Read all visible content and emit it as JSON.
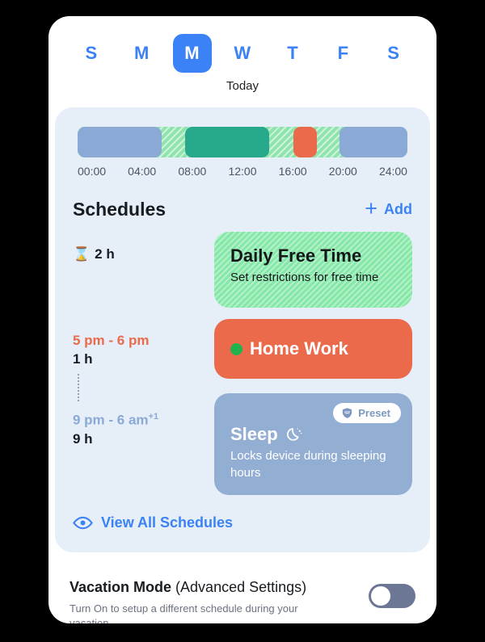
{
  "colors": {
    "accent_blue": "#3b82f6",
    "panel_bg": "#e6eef8",
    "card_green": "#85e8a8",
    "card_orange": "#ec6a4c",
    "card_blue": "#93aed3",
    "timeline_green": "#8fe4ae",
    "timeline_blue": "#8aaad5",
    "timeline_teal": "#27a98b",
    "timeline_orange": "#ec6a4c",
    "toggle_off": "#6b7795"
  },
  "day_selector": {
    "today_label": "Today",
    "days": [
      {
        "label": "S",
        "selected": false
      },
      {
        "label": "M",
        "selected": false
      },
      {
        "label": "M",
        "selected": true
      },
      {
        "label": "W",
        "selected": false
      },
      {
        "label": "T",
        "selected": false
      },
      {
        "label": "F",
        "selected": false
      },
      {
        "label": "S",
        "selected": false
      }
    ]
  },
  "timeline": {
    "tick_labels": [
      "00:00",
      "04:00",
      "08:00",
      "12:00",
      "16:00",
      "20:00",
      "24:00"
    ],
    "background_fill": "free-time-striped-green",
    "segments": [
      {
        "name": "sleep-morning",
        "color": "#8aaad5",
        "left_pct": 0.0,
        "width_pct": 25.5
      },
      {
        "name": "school",
        "color": "#27a98b",
        "left_pct": 32.5,
        "width_pct": 25.5
      },
      {
        "name": "home-work",
        "color": "#ec6a4c",
        "left_pct": 65.5,
        "width_pct": 7.0
      },
      {
        "name": "sleep-night",
        "color": "#8aaad5",
        "left_pct": 79.5,
        "width_pct": 20.5
      }
    ]
  },
  "schedules_section": {
    "title": "Schedules",
    "add_label": "Add",
    "add_icon": "plus-icon",
    "view_all_label": "View All Schedules",
    "view_all_icon": "eye-icon"
  },
  "schedules": [
    {
      "meta_icon": "hourglass-icon",
      "meta_time": "",
      "meta_time_sup": "",
      "duration": "2 h",
      "time_color": "#181c20",
      "card_style": "green",
      "title": "Daily Free Time",
      "title_icon": "",
      "subtitle": "Set restrictions for free time",
      "badge": null
    },
    {
      "meta_icon": "",
      "meta_time": "5 pm - 6 pm",
      "meta_time_sup": "",
      "duration": "1 h",
      "time_color": "#ec6a4c",
      "card_style": "orange",
      "title": "Home Work",
      "title_icon": "green-dot-icon",
      "subtitle": "",
      "badge": null
    },
    {
      "meta_icon": "",
      "meta_time": "9 pm - 6 am",
      "meta_time_sup": "+1",
      "duration": "9 h",
      "time_color": "#8aaad5",
      "card_style": "blue",
      "title": "Sleep",
      "title_icon": "crescent-moon-icon",
      "subtitle": "Locks device during sleeping hours",
      "badge": {
        "label": "Preset",
        "icon": "shield-icon"
      }
    }
  ],
  "vacation_mode": {
    "title_bold": "Vacation Mode",
    "title_light": "(Advanced Settings)",
    "subtitle": "Turn On to setup a different schedule during your vacation",
    "toggle_state": "off"
  }
}
